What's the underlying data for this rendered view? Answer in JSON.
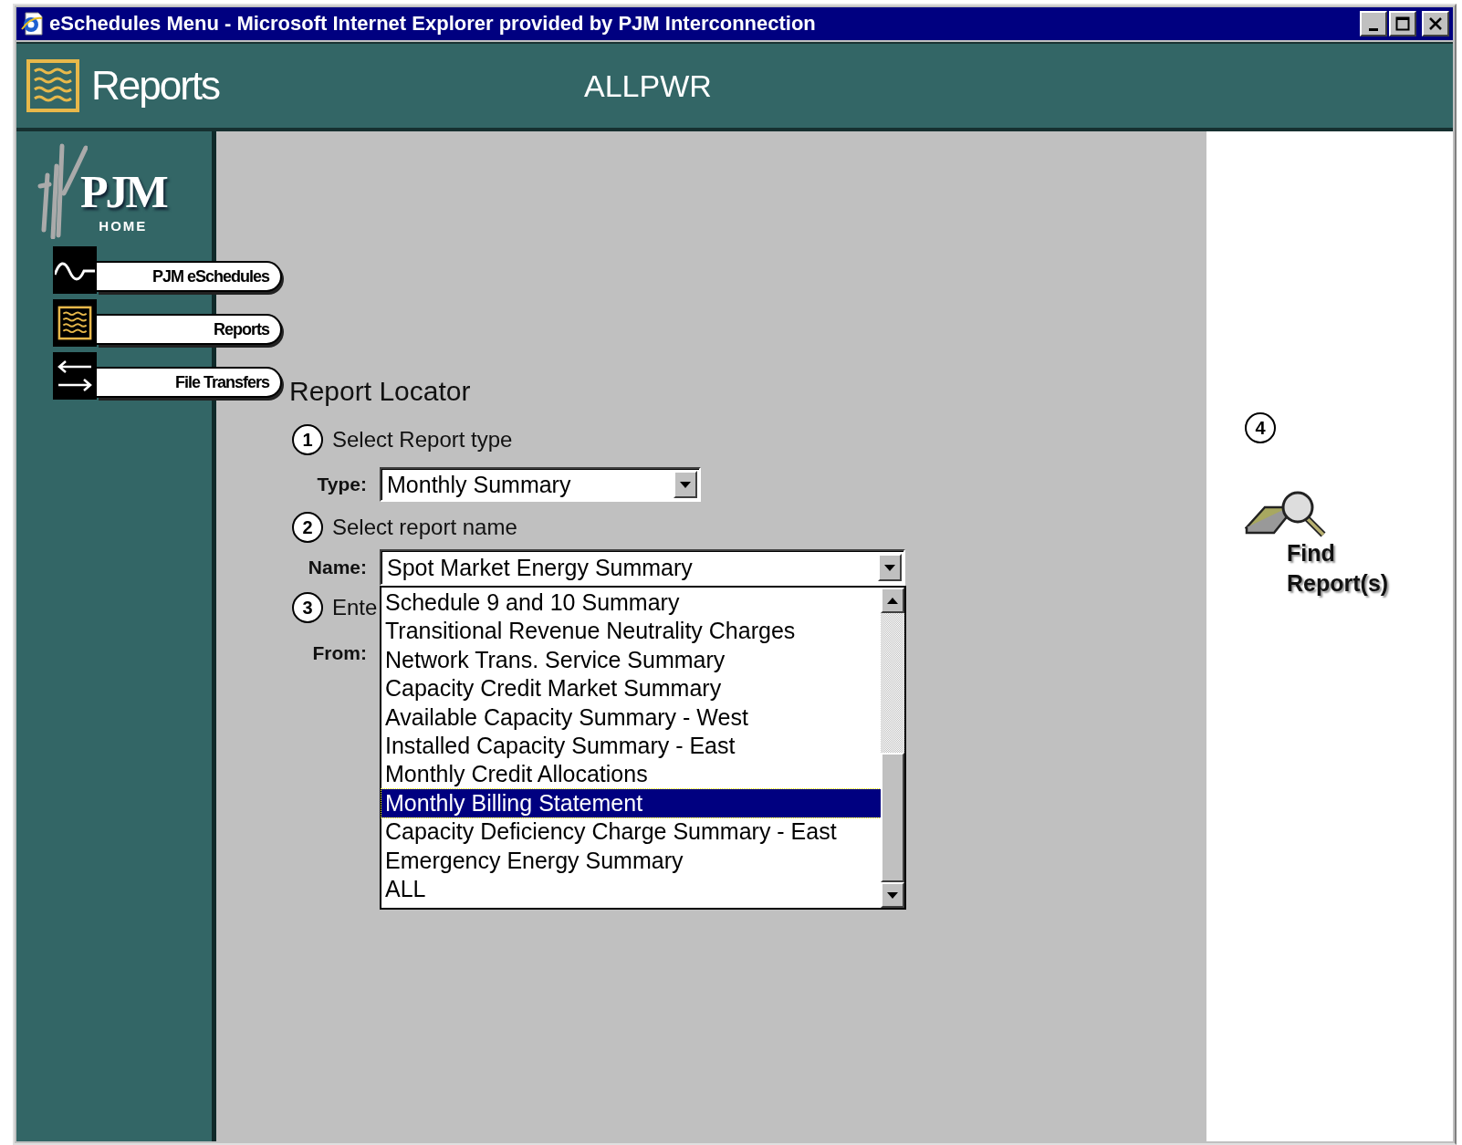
{
  "window": {
    "title": "eSchedules Menu - Microsoft Internet Explorer provided by PJM Interconnection"
  },
  "header": {
    "section": "Reports",
    "user": "ALLPWR"
  },
  "sidebar": {
    "logo": {
      "name": "PJM",
      "caption": "HOME"
    },
    "items": [
      {
        "label": "PJM eSchedules",
        "kind": "wave"
      },
      {
        "label": "Reports",
        "kind": "report"
      },
      {
        "label": "File Transfers",
        "kind": "transfer"
      }
    ]
  },
  "locator": {
    "title": "Report Locator",
    "steps": [
      {
        "number": "1",
        "label": "Select Report type"
      },
      {
        "number": "2",
        "label": "Select report name"
      },
      {
        "number": "3",
        "label": "Ente"
      }
    ],
    "type_field": {
      "label": "Type:",
      "value": "Monthly Summary"
    },
    "name_field": {
      "label": "Name:",
      "value": "Spot Market Energy Summary",
      "expanded": true,
      "options": [
        {
          "label": "Schedule 9 and 10 Summary",
          "selected": false
        },
        {
          "label": "Transitional Revenue Neutrality Charges",
          "selected": false
        },
        {
          "label": "Network Trans. Service Summary",
          "selected": false
        },
        {
          "label": "Capacity Credit Market Summary",
          "selected": false
        },
        {
          "label": "Available Capacity Summary - West",
          "selected": false
        },
        {
          "label": "Installed Capacity Summary - East",
          "selected": false
        },
        {
          "label": "Monthly Credit Allocations",
          "selected": false
        },
        {
          "label": "Monthly Billing Statement",
          "selected": true
        },
        {
          "label": "Capacity Deficiency Charge Summary - East",
          "selected": false
        },
        {
          "label": "Emergency Energy Summary",
          "selected": false
        },
        {
          "label": "ALL",
          "selected": false
        }
      ]
    },
    "from_field": {
      "label": "From:"
    }
  },
  "find": {
    "step": "4",
    "label": "Find Report(s)"
  }
}
